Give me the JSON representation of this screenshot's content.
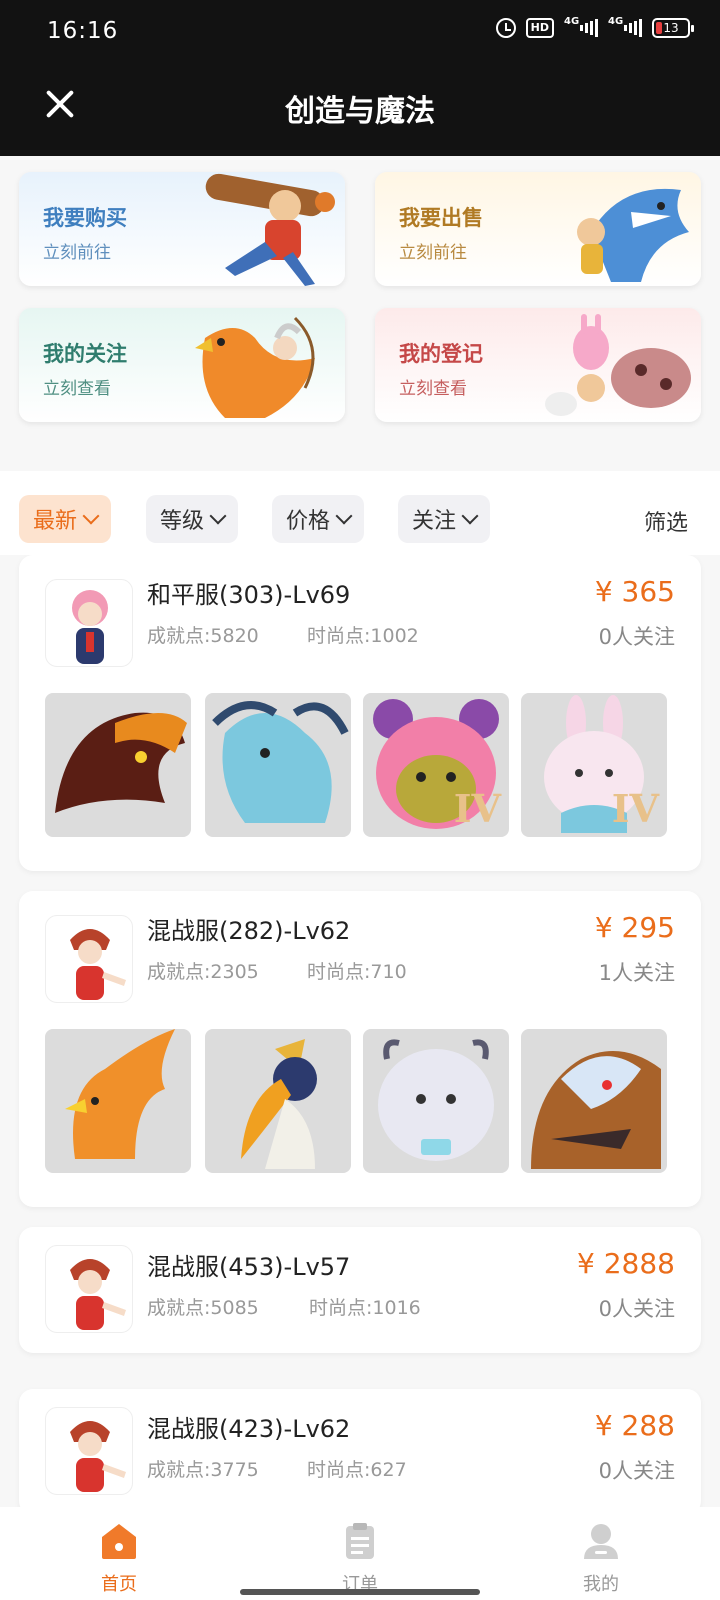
{
  "status_bar": {
    "time": "16:16",
    "hd_label": "HD",
    "network_1": "4G",
    "network_2": "4G",
    "battery": "13"
  },
  "header": {
    "title": "创造与魔法"
  },
  "entries": [
    {
      "title": "我要购买",
      "subtitle": "立刻前往",
      "icon": "woodcutter-illustration"
    },
    {
      "title": "我要出售",
      "subtitle": "立刻前往",
      "icon": "shark-illustration"
    },
    {
      "title": "我的关注",
      "subtitle": "立刻查看",
      "icon": "phoenix-archer-illustration"
    },
    {
      "title": "我的登记",
      "subtitle": "立刻查看",
      "icon": "pets-illustration"
    }
  ],
  "filters": {
    "chips": [
      "最新",
      "等级",
      "价格",
      "关注"
    ],
    "active": "最新",
    "screen_label": "筛选"
  },
  "listings": [
    {
      "server": "和平服(303)-Lv69",
      "achievement": "成就点:5820",
      "fashion": "时尚点:1002",
      "price": "¥ 365",
      "followers": "0人关注",
      "avatar": "pink-hair-girl-avatar",
      "pets": [
        "fire-dragon-pet",
        "blue-dragon-pet",
        "pink-bear-pet",
        "star-rabbit-pet"
      ],
      "pet_tiers": [
        "",
        "",
        "IV",
        "IV"
      ]
    },
    {
      "server": "混战服(282)-Lv62",
      "achievement": "成就点:2305",
      "fashion": "时尚点:710",
      "price": "¥ 295",
      "followers": "1人关注",
      "avatar": "red-hair-fighter-avatar",
      "pets": [
        "phoenix-pet",
        "hornbill-pet",
        "white-robot-cow-pet",
        "armored-wolf-pet"
      ],
      "pet_tiers": [
        "",
        "",
        "",
        ""
      ]
    },
    {
      "server": "混战服(453)-Lv57",
      "achievement": "成就点:5085",
      "fashion": "时尚点:1016",
      "price": "¥ 2888",
      "followers": "0人关注",
      "avatar": "red-hair-fighter-avatar"
    },
    {
      "server": "混战服(423)-Lv62",
      "achievement": "成就点:3775",
      "fashion": "时尚点:627",
      "price": "¥ 288",
      "followers": "0人关注",
      "avatar": "red-hair-fighter-avatar"
    }
  ],
  "tabbar": {
    "tabs": [
      "首页",
      "订单",
      "我的"
    ],
    "active": "首页"
  },
  "colors": {
    "accent": "#ea6d1b",
    "header_bg": "#121212",
    "active_chip_bg": "#fde3cf"
  }
}
